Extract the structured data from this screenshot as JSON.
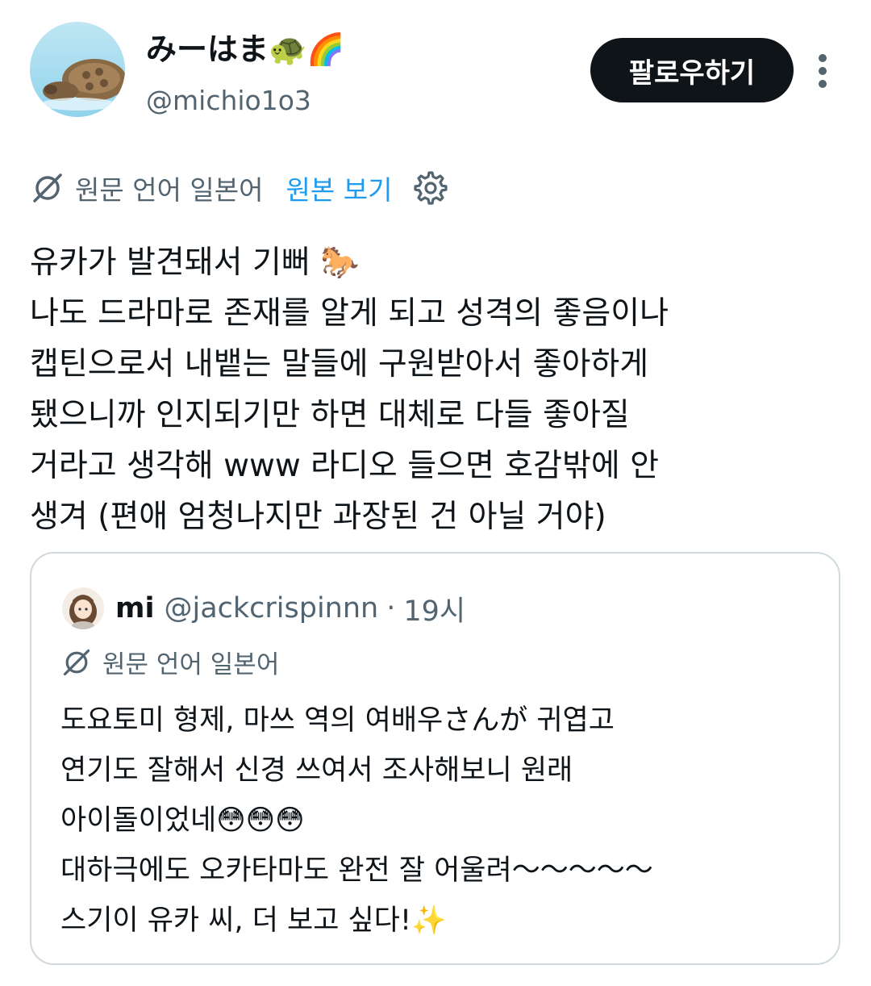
{
  "author": {
    "display_name": "みーはま🐢🌈",
    "handle": "@michio1o3"
  },
  "header": {
    "follow_label": "팔로우하기"
  },
  "translation": {
    "source_label": "원문 언어 일본어",
    "view_original_label": "원본 보기"
  },
  "tweet": {
    "text": "유카가 발견돼서 기뻐 🐎\n나도 드라마로 존재를 알게 되고 성격의 좋음이나\n캡틴으로서 내뱉는 말들에 구원받아서 좋아하게\n됐으니까 인지되기만 하면 대체로 다들 좋아질\n거라고 생각해 www 라디오 들으면 호감밖에 안\n생겨 (편애 엄청나지만 과장된 건 아닐 거야)"
  },
  "quote": {
    "name": "mi",
    "handle": "@jackcrispinnn",
    "separator": "·",
    "time": "19시",
    "translation_label": "원문 언어 일본어",
    "text": "도요토미 형제, 마쓰 역의 여배우さんが 귀엽고\n연기도 잘해서 신경 쓰여서 조사해보니 원래\n아이돌이었네😳😳😳\n대하극에도 오카타마도 완전 잘 어울려〜〜〜〜〜\n스기이 유카 씨, 더 보고 싶다!✨"
  },
  "colors": {
    "text_primary": "#0f1419",
    "text_secondary": "#536471",
    "link_blue": "#1d9bf0",
    "button_bg": "#0f1419",
    "border": "#cfd9de"
  },
  "icons": {
    "translate": "translate-icon",
    "settings": "gear-icon",
    "more": "more-vertical-icon"
  }
}
